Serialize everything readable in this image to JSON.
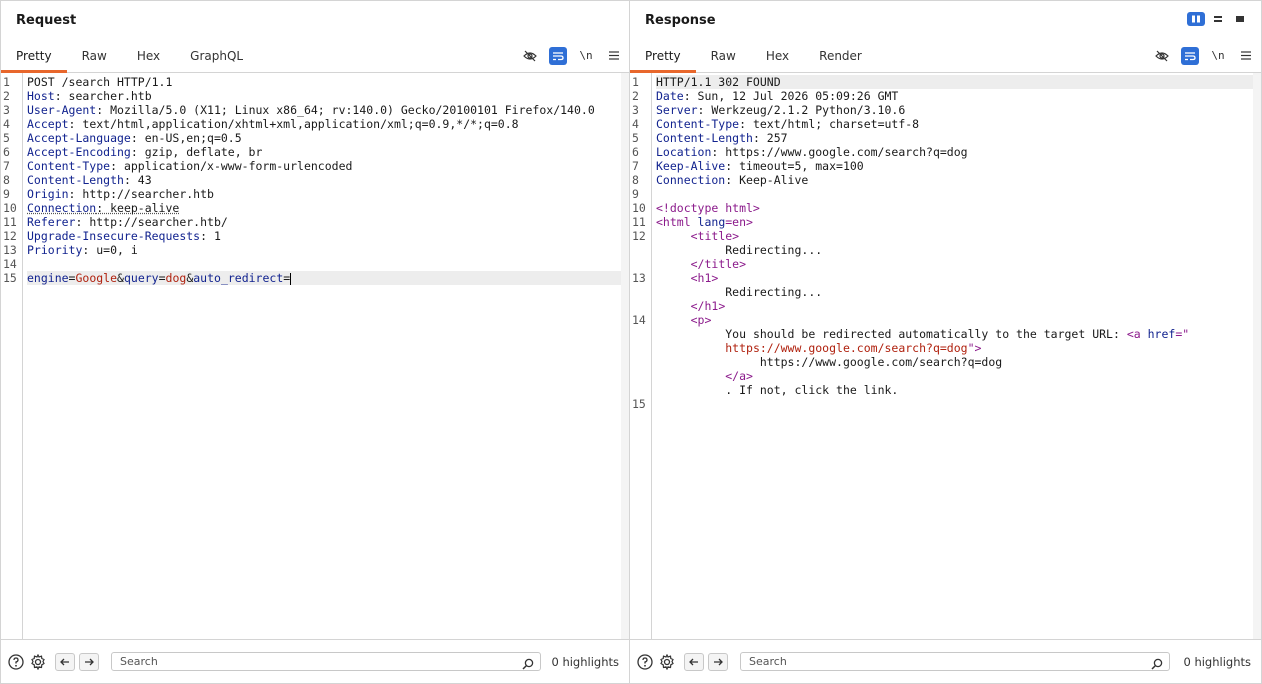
{
  "request": {
    "title": "Request",
    "tabs": [
      {
        "label": "Pretty",
        "active": true
      },
      {
        "label": "Raw"
      },
      {
        "label": "Hex"
      },
      {
        "label": "GraphQL"
      }
    ],
    "newline_toggle": "\\n",
    "line_numbers": [
      "1",
      "2",
      "3",
      "4",
      "5",
      "6",
      "7",
      "8",
      "9",
      "10",
      "11",
      "12",
      "13",
      "14",
      "15"
    ],
    "lines": {
      "l1": "POST /search HTTP/1.1",
      "l2k": "Host",
      "l2v": ": searcher.htb",
      "l3k": "User-Agent",
      "l3v": ": Mozilla/5.0 (X11; Linux x86_64; rv:140.0) Gecko/20100101 Firefox/140.0",
      "l4k": "Accept",
      "l4v": ": text/html,application/xhtml+xml,application/xml;q=0.9,*/*;q=0.8",
      "l5k": "Accept-Language",
      "l5v": ": en-US,en;q=0.5",
      "l6k": "Accept-Encoding",
      "l6v": ": gzip, deflate, br",
      "l7k": "Content-Type",
      "l7v": ": application/x-www-form-urlencoded",
      "l8k": "Content-Length",
      "l8v": ": 43",
      "l9k": "Origin",
      "l9v": ": http://searcher.htb",
      "l10k": "Connection",
      "l10v": ": keep-alive",
      "l11k": "Referer",
      "l11v": ": http://searcher.htb/",
      "l12k": "Upgrade-Insecure-Requests",
      "l12v": ": 1",
      "l13k": "Priority",
      "l13v": ": u=0, i",
      "l15": {
        "p1k": "engine",
        "p1v": "Google",
        "p2k": "query",
        "p2v": "dog",
        "p3k": "auto_redirect",
        "p3v": ""
      }
    },
    "footer": {
      "search_placeholder": "Search",
      "highlights": "0 highlights"
    }
  },
  "response": {
    "title": "Response",
    "tabs": [
      {
        "label": "Pretty",
        "active": true
      },
      {
        "label": "Raw"
      },
      {
        "label": "Hex"
      },
      {
        "label": "Render"
      }
    ],
    "newline_toggle": "\\n",
    "line_numbers": [
      "1",
      "2",
      "3",
      "4",
      "5",
      "6",
      "7",
      "8",
      "9",
      "10",
      "11",
      "12",
      "",
      "",
      "13",
      "",
      "",
      "14",
      "",
      "",
      "",
      "",
      "",
      "15"
    ],
    "lines": {
      "l1": "HTTP/1.1 302 FOUND",
      "l2k": "Date",
      "l2v": ": Sun, 12 Jul 2026 05:09:26 GMT",
      "l3k": "Server",
      "l3v": ": Werkzeug/2.1.2 Python/3.10.6",
      "l4k": "Content-Type",
      "l4v": ": text/html; charset=utf-8",
      "l5k": "Content-Length",
      "l5v": ": 257",
      "l6k": "Location",
      "l6v": ": https://www.google.com/search?q=dog",
      "l7k": "Keep-Alive",
      "l7v": ": timeout=5, max=100",
      "l8k": "Connection",
      "l8v": ": Keep-Alive",
      "l10": "<!doctype html>",
      "l11a": "<html ",
      "l11b": "lang",
      "l11c": "=en>",
      "l12a": "<title>",
      "l12b": "Redirecting...",
      "l12c": "</title>",
      "l13a": "<h1>",
      "l13b": "Redirecting...",
      "l13c": "</h1>",
      "l14a": "<p>",
      "l14b": "You should be redirected automatically to the target URL: ",
      "l14c": "<a ",
      "l14d": "href",
      "l14e": "=\"",
      "l14f": "https://www.google.com/search?q=dog",
      "l14g": "\">",
      "l14h": "https://www.google.com/search?q=dog",
      "l14i": "</a>",
      "l14j": ". If not, click the link."
    },
    "footer": {
      "search_placeholder": "Search",
      "highlights": "0 highlights"
    }
  },
  "layout_modes": [
    "side-by-side",
    "stacked",
    "single"
  ],
  "colors": {
    "accent_tab": "#e8672c",
    "active_toggle": "#2f6fd6",
    "header_key": "#12238f",
    "param_value": "#b0220f",
    "html_tag": "#8b1a8b"
  }
}
